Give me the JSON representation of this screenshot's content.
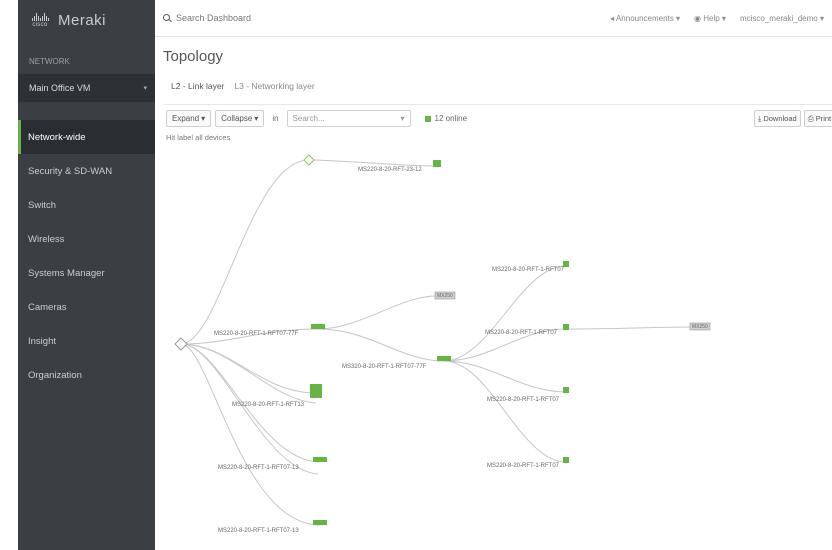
{
  "brand": {
    "logo_text": "cisco",
    "name": "Meraki"
  },
  "network": {
    "label": "NETWORK",
    "selected": "Main Office VM"
  },
  "nav": [
    {
      "label": "Network-wide",
      "active": true
    },
    {
      "label": "Security & SD-WAN",
      "active": false
    },
    {
      "label": "Switch",
      "active": false
    },
    {
      "label": "Wireless",
      "active": false
    },
    {
      "label": "Systems Manager",
      "active": false
    },
    {
      "label": "Cameras",
      "active": false
    },
    {
      "label": "Insight",
      "active": false
    },
    {
      "label": "Organization",
      "active": false
    }
  ],
  "topbar": {
    "search_placeholder": "Search Dashboard",
    "announcements": "Announcements",
    "help": "Help",
    "account": "mcisco_meraki_demo"
  },
  "page": {
    "title": "Topology"
  },
  "tabs": [
    {
      "label": "L2 - Link layer",
      "active": true
    },
    {
      "label": "L3 - Networking layer",
      "active": false
    }
  ],
  "toolbar": {
    "expand": "Expand",
    "collapse": "Collapse",
    "in_label": "in",
    "device_placeholder": "Search...",
    "online_text": "12 online",
    "download": "Download",
    "print": "Print"
  },
  "caption": "Hit label all devices",
  "topology": {
    "nodes": [
      {
        "id": "root",
        "label": ""
      },
      {
        "id": "hub1",
        "label": ""
      },
      {
        "id": "sw-a",
        "label": "MS220-8-20-RFT-23-12"
      },
      {
        "id": "sw-b",
        "label": "MS220-8-20-RFT-1-RFT07-77F"
      },
      {
        "id": "sw-c",
        "label": "MS220-8-20-RFT-1-RFT13"
      },
      {
        "id": "sw-d",
        "label": "MS220-8-20-RFT-1-RFT07-13"
      },
      {
        "id": "sw-e",
        "label": "MS220-8-20-RFT-1-RFT07-13"
      },
      {
        "id": "dev1",
        "label": "MX250"
      },
      {
        "id": "sw-f",
        "label": "MS320-8-20-RFT-1-RFT07-77F"
      },
      {
        "id": "sw-g",
        "label": "MS220-8-20-RFT-1-RFT07"
      },
      {
        "id": "sw-h",
        "label": "MS220-8-20-RFT-1-RFT07"
      },
      {
        "id": "sw-i",
        "label": "MS220-8-20-RFT-1-RFT07"
      },
      {
        "id": "sw-j",
        "label": "MS220-8-20-RFT-1-RFT07"
      },
      {
        "id": "dev2",
        "label": "MX250"
      }
    ]
  },
  "colors": {
    "online": "#67b346",
    "sidebar": "#3b3f44",
    "link": "#bdbdbd"
  }
}
